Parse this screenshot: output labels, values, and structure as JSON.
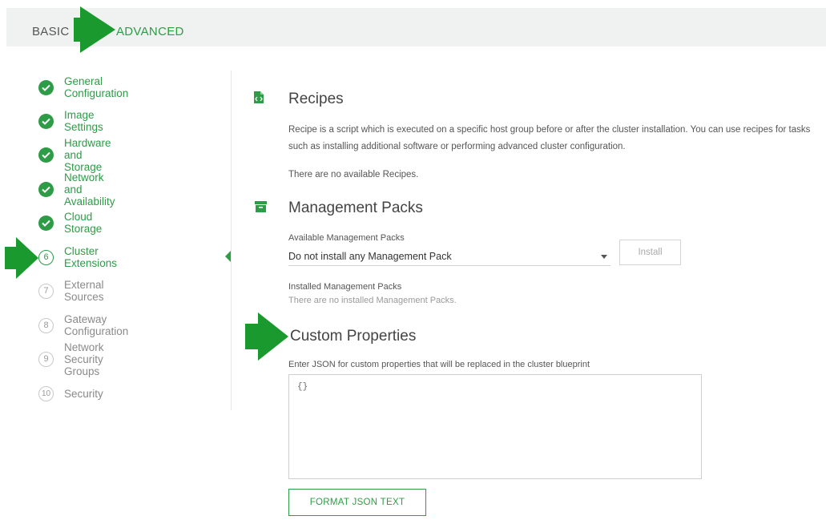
{
  "tabs": {
    "basic": "BASIC",
    "advanced": "ADVANCED"
  },
  "steps": [
    {
      "num": "1",
      "label": "General Configuration",
      "state": "done"
    },
    {
      "num": "2",
      "label": "Image Settings",
      "state": "done"
    },
    {
      "num": "3",
      "label": "Hardware and Storage",
      "state": "done"
    },
    {
      "num": "4",
      "label": "Network and Availability",
      "state": "done"
    },
    {
      "num": "5",
      "label": "Cloud Storage",
      "state": "done"
    },
    {
      "num": "6",
      "label": "Cluster Extensions",
      "state": "current"
    },
    {
      "num": "7",
      "label": "External Sources",
      "state": "todo"
    },
    {
      "num": "8",
      "label": "Gateway Configuration",
      "state": "todo"
    },
    {
      "num": "9",
      "label": "Network Security Groups",
      "state": "todo"
    },
    {
      "num": "10",
      "label": "Security",
      "state": "todo"
    }
  ],
  "recipes": {
    "title": "Recipes",
    "icon": "file-code-icon",
    "description": "Recipe is a script which is executed on a specific host group before or after the cluster installation. You can use recipes for tasks such as installing additional software or performing advanced cluster configuration.",
    "empty": "There are no available Recipes."
  },
  "mpacks": {
    "title": "Management Packs",
    "icon": "archive-icon",
    "available_label": "Available Management Packs",
    "selected": "Do not install any Management Pack",
    "install_label": "Install",
    "installed_label": "Installed Management Packs",
    "installed_empty": "There are no installed Management Packs."
  },
  "custom": {
    "title": "Custom Properties",
    "hint": "Enter JSON for custom properties that will be replaced in the cluster blueprint",
    "value": "{}",
    "format_label": "FORMAT JSON TEXT"
  },
  "colors": {
    "accent": "#2e9b47",
    "arrow": "#1a9a2e"
  }
}
